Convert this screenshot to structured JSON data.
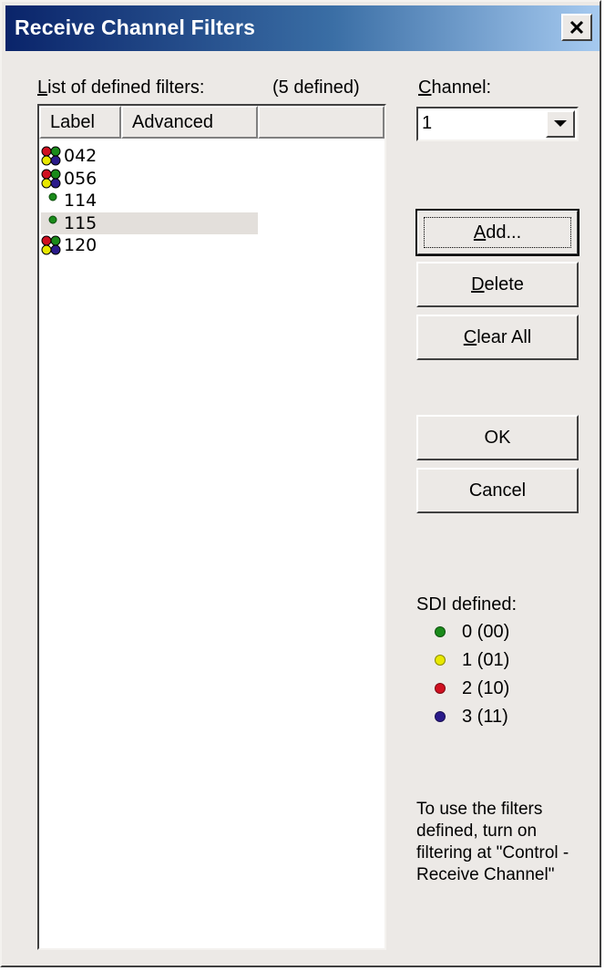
{
  "window": {
    "title": "Receive Channel Filters",
    "close_glyph": "✕"
  },
  "list": {
    "label_prefix": "L",
    "label_rest": "ist of defined filters:",
    "count_text": "(5 defined)",
    "columns": [
      "Label",
      "Advanced"
    ],
    "rows": [
      {
        "label": "042",
        "icon": "multi-sdi-icon",
        "selected": false
      },
      {
        "label": "056",
        "icon": "multi-sdi-icon",
        "selected": false
      },
      {
        "label": "114",
        "icon": "sdi-0-dot-icon",
        "selected": false
      },
      {
        "label": "115",
        "icon": "sdi-0-dot-icon",
        "selected": true
      },
      {
        "label": "120",
        "icon": "multi-sdi-icon",
        "selected": false
      }
    ]
  },
  "channel": {
    "label_prefix": "C",
    "label_rest": "hannel:",
    "value": "1"
  },
  "buttons": {
    "add": {
      "prefix": "A",
      "rest": "dd..."
    },
    "delete": {
      "prefix": "D",
      "rest": "elete"
    },
    "clear_all": {
      "prefix": "C",
      "rest": "lear All"
    },
    "ok": "OK",
    "cancel": "Cancel"
  },
  "sdi_legend": {
    "title": "SDI defined:",
    "items": [
      {
        "text": "0 (00)",
        "color": "#1a8a1a"
      },
      {
        "text": "1 (01)",
        "color": "#e8e800"
      },
      {
        "text": "2 (10)",
        "color": "#d01020"
      },
      {
        "text": "3 (11)",
        "color": "#2a1a8a"
      }
    ]
  },
  "note": "To use the filters defined, turn on filtering at \"Control - Receive Channel\"",
  "colors": {
    "title_start": "#0a246a",
    "title_end": "#a6caf0",
    "face": "#ece9e6",
    "selection": "#e3dfdb"
  }
}
